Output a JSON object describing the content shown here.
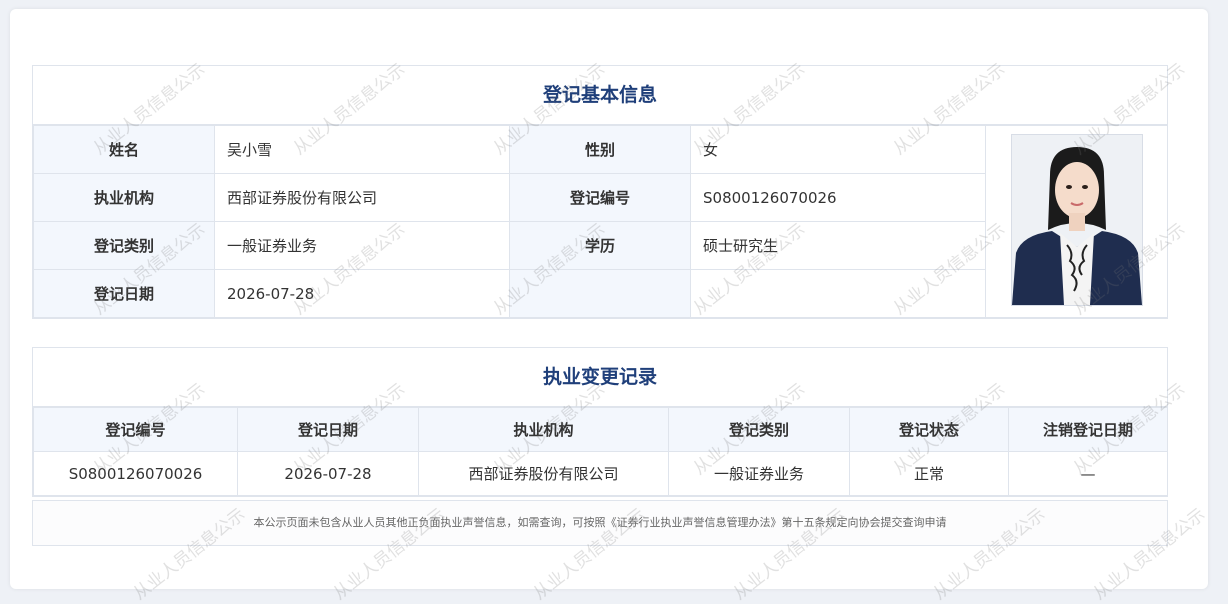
{
  "basic": {
    "title": "登记基本信息",
    "rows": [
      {
        "l1": "姓名",
        "v1": "吴小雪",
        "l2": "性别",
        "v2": "女"
      },
      {
        "l1": "执业机构",
        "v1": "西部证券股份有限公司",
        "l2": "登记编号",
        "v2": "S0800126070026"
      },
      {
        "l1": "登记类别",
        "v1": "一般证券业务",
        "l2": "学历",
        "v2": "硕士研究生"
      },
      {
        "l1": "登记日期",
        "v1": "2026-07-28",
        "l2": "",
        "v2": ""
      }
    ]
  },
  "changes": {
    "title": "执业变更记录",
    "headers": [
      "登记编号",
      "登记日期",
      "执业机构",
      "登记类别",
      "登记状态",
      "注销登记日期"
    ],
    "rows": [
      [
        "S0800126070026",
        "2026-07-28",
        "西部证券股份有限公司",
        "一般证券业务",
        "正常",
        "—"
      ]
    ]
  },
  "notice": "本公示页面未包含从业人员其他正负面执业声誉信息，如需查询，可按照《证券行业执业声誉信息管理办法》第十五条规定向协会提交查询申请",
  "watermark": "从业人员信息公示",
  "colors": {
    "title": "#1f3f7a",
    "label_bg": "#f3f7fd",
    "border": "#dfe4ec"
  }
}
